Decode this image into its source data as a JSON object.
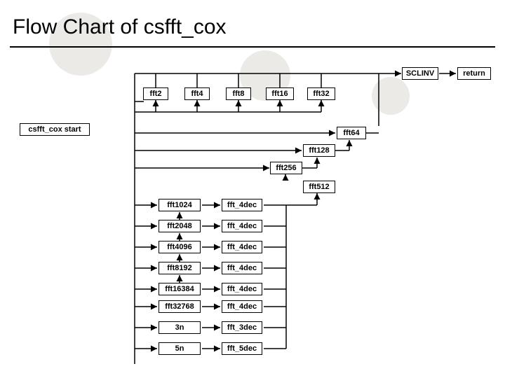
{
  "title": "Flow Chart of csfft_cox",
  "boxes": {
    "start": "csfft_cox start",
    "sclinv": "SCLINV",
    "ret": "return",
    "fft2": "fft2",
    "fft4": "fft4",
    "fft8": "fft8",
    "fft16": "fft16",
    "fft32": "fft32",
    "fft64": "fft64",
    "fft128": "fft128",
    "fft256": "fft256",
    "fft512": "fft512",
    "fft1024": "fft1024",
    "fft2048": "fft2048",
    "fft4096": "fft4096",
    "fft8192": "fft8192",
    "fft16384": "fft16384",
    "fft32768": "fft32768",
    "n3": "3n",
    "n5": "5n",
    "dec4a": "fft_4dec",
    "dec4b": "fft_4dec",
    "dec4c": "fft_4dec",
    "dec4d": "fft_4dec",
    "dec4e": "fft_4dec",
    "dec4f": "fft_4dec",
    "dec3": "fft_3dec",
    "dec5": "fft_5dec"
  }
}
